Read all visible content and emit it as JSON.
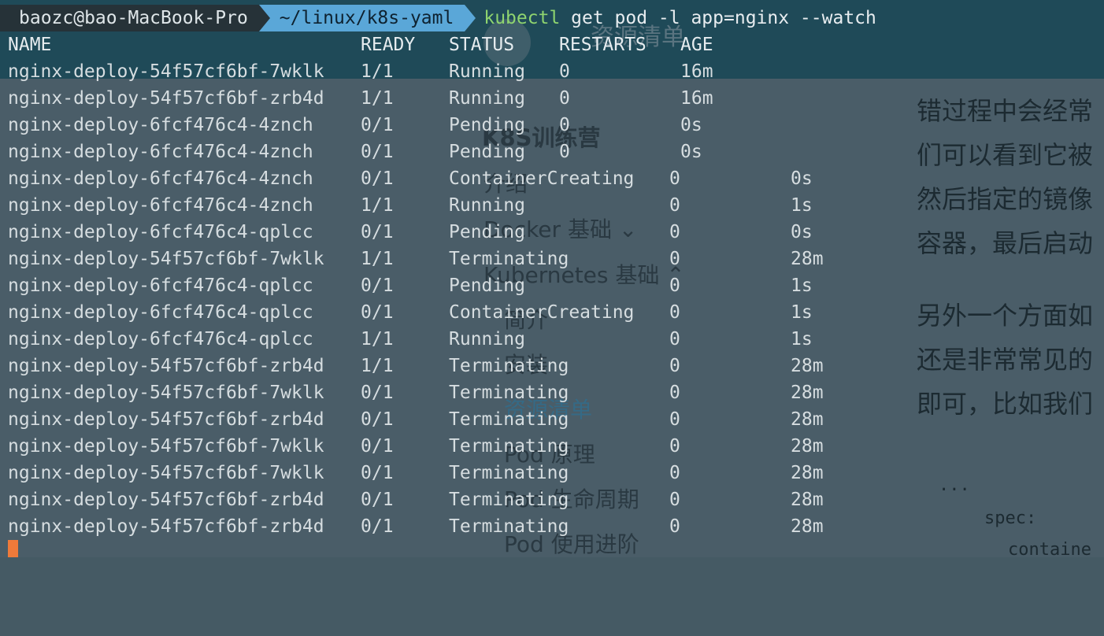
{
  "terminal": {
    "prompt_user": "baozc@bao-MacBook-Pro",
    "prompt_path": "~/linux/k8s-yaml",
    "command_keyword": "kubectl",
    "command_args": " get pod -l app=nginx --watch",
    "header": {
      "name": "NAME",
      "ready": "READY",
      "status": "STATUS",
      "restarts": "RESTARTS",
      "age": "AGE"
    },
    "rows": [
      {
        "name": "nginx-deploy-54f57cf6bf-7wklk",
        "ready": "1/1",
        "status": "Running",
        "restarts": "0",
        "age": "16m"
      },
      {
        "name": "nginx-deploy-54f57cf6bf-zrb4d",
        "ready": "1/1",
        "status": "Running",
        "restarts": "0",
        "age": "16m"
      },
      {
        "name": "nginx-deploy-6fcf476c4-4znch",
        "ready": "0/1",
        "status": "Pending",
        "restarts": "0",
        "age": "0s"
      },
      {
        "name": "nginx-deploy-6fcf476c4-4znch",
        "ready": "0/1",
        "status": "Pending",
        "restarts": "0",
        "age": "0s"
      },
      {
        "name": "nginx-deploy-6fcf476c4-4znch",
        "ready": "0/1",
        "status": "ContainerCreating",
        "restarts": "0",
        "age": "0s"
      },
      {
        "name": "nginx-deploy-6fcf476c4-4znch",
        "ready": "1/1",
        "status": "Running",
        "restarts": "0",
        "age": "1s"
      },
      {
        "name": "nginx-deploy-6fcf476c4-qplcc",
        "ready": "0/1",
        "status": "Pending",
        "restarts": "0",
        "age": "0s"
      },
      {
        "name": "nginx-deploy-54f57cf6bf-7wklk",
        "ready": "1/1",
        "status": "Terminating",
        "restarts": "0",
        "age": "28m"
      },
      {
        "name": "nginx-deploy-6fcf476c4-qplcc",
        "ready": "0/1",
        "status": "Pending",
        "restarts": "0",
        "age": "1s"
      },
      {
        "name": "nginx-deploy-6fcf476c4-qplcc",
        "ready": "0/1",
        "status": "ContainerCreating",
        "restarts": "0",
        "age": "1s"
      },
      {
        "name": "nginx-deploy-6fcf476c4-qplcc",
        "ready": "1/1",
        "status": "Running",
        "restarts": "0",
        "age": "1s"
      },
      {
        "name": "nginx-deploy-54f57cf6bf-zrb4d",
        "ready": "1/1",
        "status": "Terminating",
        "restarts": "0",
        "age": "28m"
      },
      {
        "name": "nginx-deploy-54f57cf6bf-7wklk",
        "ready": "0/1",
        "status": "Terminating",
        "restarts": "0",
        "age": "28m"
      },
      {
        "name": "nginx-deploy-54f57cf6bf-zrb4d",
        "ready": "0/1",
        "status": "Terminating",
        "restarts": "0",
        "age": "28m"
      },
      {
        "name": "nginx-deploy-54f57cf6bf-7wklk",
        "ready": "0/1",
        "status": "Terminating",
        "restarts": "0",
        "age": "28m"
      },
      {
        "name": "nginx-deploy-54f57cf6bf-7wklk",
        "ready": "0/1",
        "status": "Terminating",
        "restarts": "0",
        "age": "28m"
      },
      {
        "name": "nginx-deploy-54f57cf6bf-zrb4d",
        "ready": "0/1",
        "status": "Terminating",
        "restarts": "0",
        "age": "28m"
      },
      {
        "name": "nginx-deploy-54f57cf6bf-zrb4d",
        "ready": "0/1",
        "status": "Terminating",
        "restarts": "0",
        "age": "28m"
      }
    ],
    "colors": {
      "cursor": "#ef7a3a",
      "path_bg": "#5aa7d8",
      "keyword": "#8fd46f"
    }
  },
  "background_page": {
    "top_title": "资源清单",
    "sidebar_title": "K8S训练营",
    "nav": [
      "介绍",
      "Docker 基础 ⌄",
      "Kubernetes 基础 ⌃",
      "简介",
      "安装",
      "资源清单",
      "Pod 原理",
      "Pod 生命周期",
      "Pod 使用进阶"
    ],
    "doc_lines": [
      "错过程中会经常",
      "们可以看到它被",
      "然后指定的镜像",
      "容器，最后启动",
      "另外一个方面如",
      "还是非常常见的",
      "即可，比如我们"
    ],
    "code_lines": [
      "...",
      "spec:",
      "containe"
    ]
  }
}
